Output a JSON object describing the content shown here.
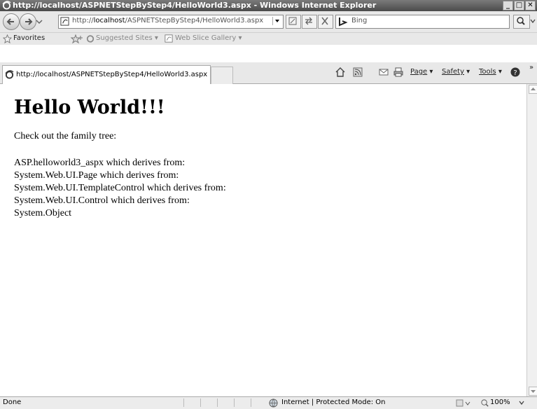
{
  "window": {
    "title": "http://localhost/ASPNETStepByStep4/HelloWorld3.aspx - Windows Internet Explorer"
  },
  "address_bar": {
    "url_prefix": "http://",
    "url_host": "localhost",
    "url_path": "/ASPNETStepByStep4/HelloWorld3.aspx"
  },
  "search": {
    "placeholder": "Bing"
  },
  "favorites_bar": {
    "favorites_label": "Favorites",
    "suggested_sites_label": "Suggested Sites ▾",
    "web_slice_gallery_label": "Web Slice Gallery ▾"
  },
  "tab": {
    "title": "http://localhost/ASPNETStepByStep4/HelloWorld3.aspx"
  },
  "command_bar": {
    "page_label": "Page",
    "safety_label": "Safety",
    "tools_label": "Tools"
  },
  "page": {
    "heading": "Hello World!!!",
    "intro": "Check out the family tree:",
    "lines": [
      "ASP.helloworld3_aspx which derives from:",
      "System.Web.UI.Page which derives from:",
      "System.Web.UI.TemplateControl which derives from:",
      "System.Web.UI.Control which derives from:",
      "System.Object"
    ]
  },
  "status_bar": {
    "status": "Done",
    "zone": "Internet | Protected Mode: On",
    "zoom": "100%"
  }
}
